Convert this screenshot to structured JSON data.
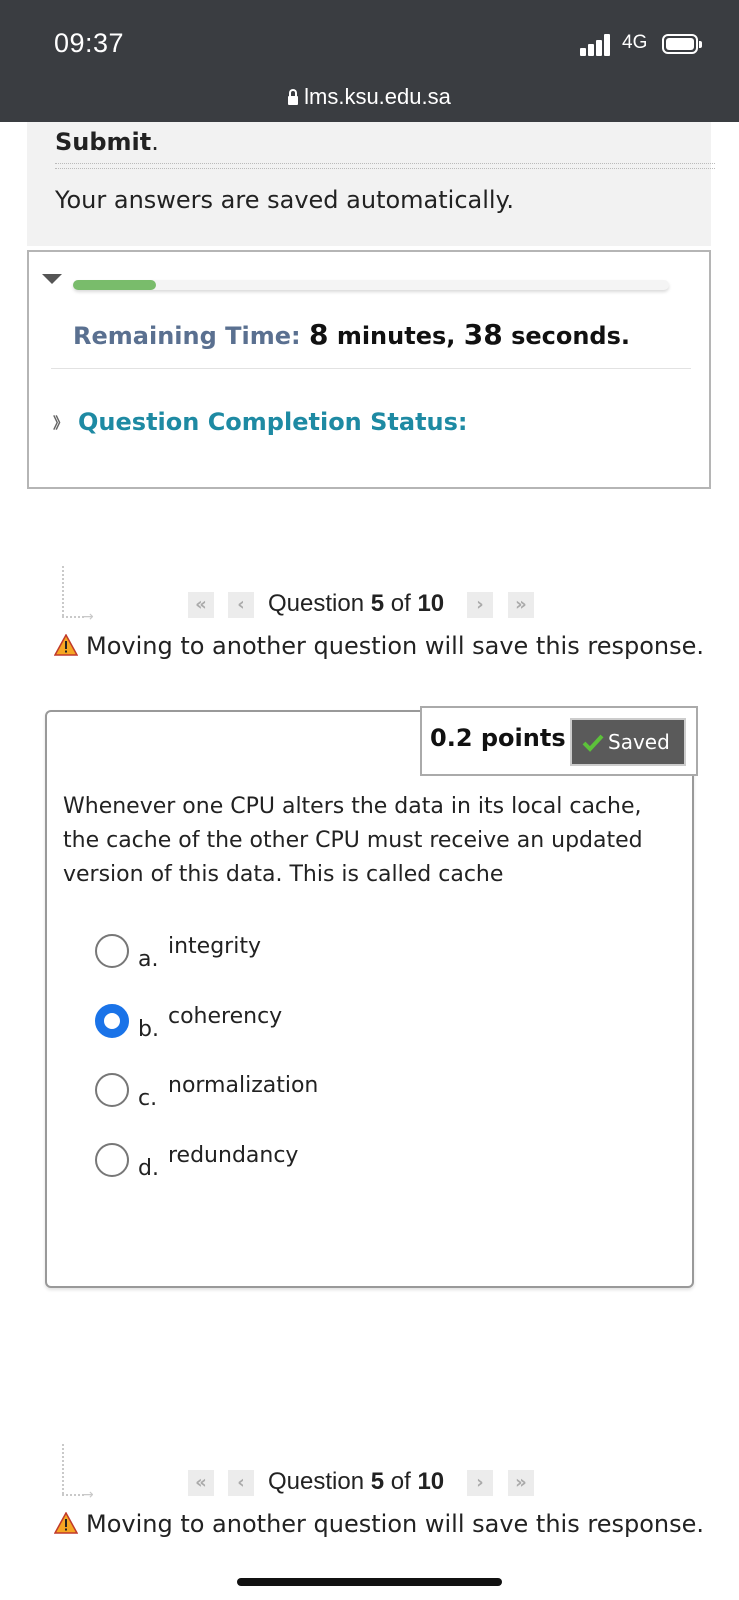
{
  "status_bar": {
    "time": "09:37",
    "network": "4G",
    "url": "lms.ksu.edu.sa"
  },
  "instructions": {
    "submit_label": "Submit",
    "submit_period": ".",
    "autosave_text": "Your answers are saved automatically."
  },
  "timer": {
    "progress_fraction": 0.14,
    "remaining_label": "Remaining Time:",
    "minutes_value": "8",
    "minutes_unit": "minutes,",
    "seconds_value": "38",
    "seconds_unit": "seconds.",
    "completion_status_label": "Question Completion Status:"
  },
  "nav_top": {
    "question_prefix": "Question",
    "current": "5",
    "of_word": "of",
    "total": "10",
    "warning": "Moving to another question will save this response."
  },
  "question": {
    "points": "0.2 points",
    "saved_label": "Saved",
    "text": "Whenever one CPU alters the data in its local cache, the cache of the other CPU must receive an updated version of this data. This is called cache",
    "options": [
      {
        "letter": "a.",
        "text": "integrity",
        "selected": false
      },
      {
        "letter": "b.",
        "text": "coherency",
        "selected": true
      },
      {
        "letter": "c.",
        "text": "normalization",
        "selected": false
      },
      {
        "letter": "d.",
        "text": "redundancy",
        "selected": false
      }
    ]
  },
  "nav_bottom": {
    "question_prefix": "Question",
    "current": "5",
    "of_word": "of",
    "total": "10",
    "warning": "Moving to another question will save this response."
  },
  "colors": {
    "status_bar_bg": "#3a3d41",
    "progress_fill": "#79bc6b",
    "remaining_label": "#5a7090",
    "completion_status": "#1e8aa3",
    "radio_selected": "#1a73e8",
    "saved_bg": "#5a5a5a",
    "warning_icon": "#f5a623"
  },
  "icons": {
    "lock": "lock-icon",
    "signal": "signal-bars-icon",
    "battery": "battery-icon",
    "collapse": "triangle-down-icon",
    "expand": "double-chevron-down-icon",
    "first": "double-chevron-left-icon",
    "prev": "chevron-left-icon",
    "next": "chevron-right-icon",
    "last": "double-chevron-right-icon",
    "warning": "warning-icon",
    "saved_check": "checkmark-icon"
  }
}
